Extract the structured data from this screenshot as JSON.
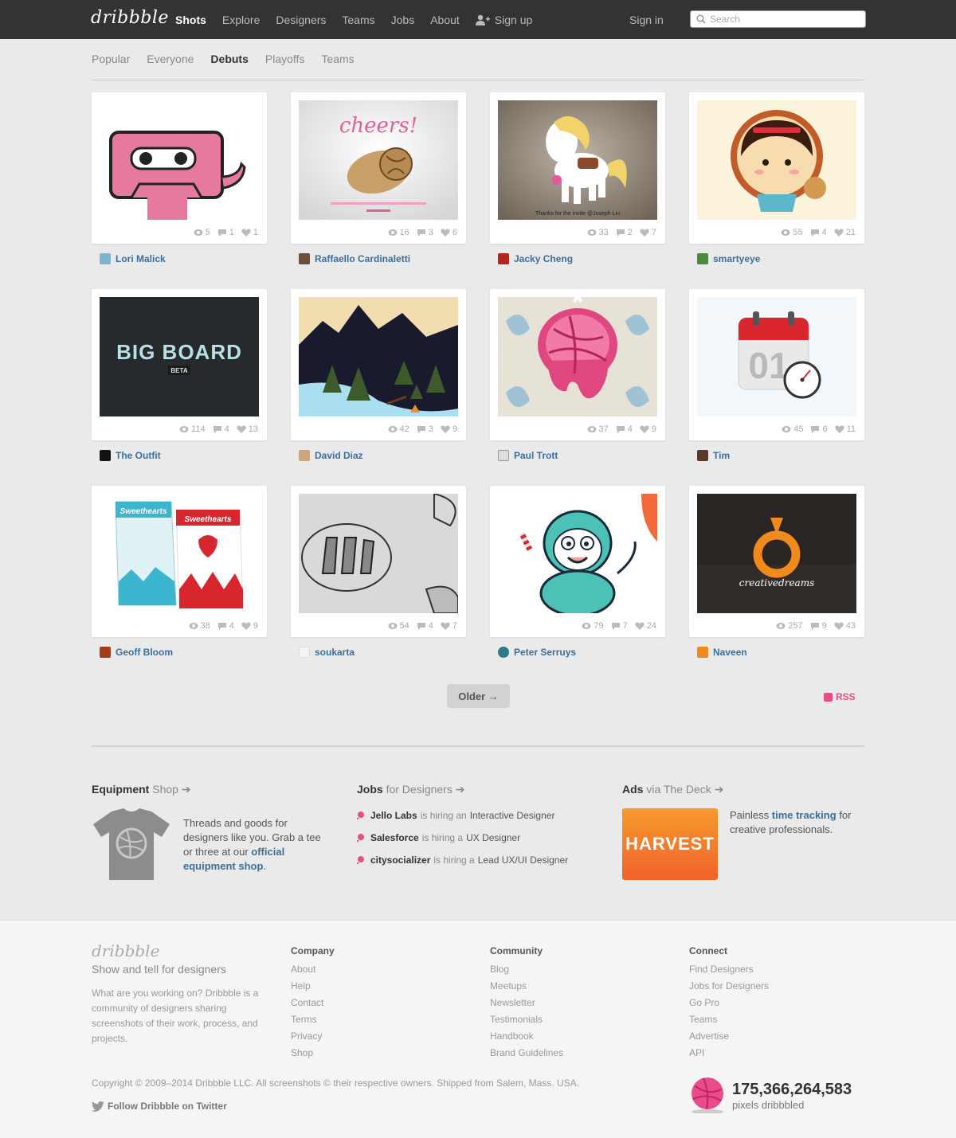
{
  "brand": "dribbble",
  "nav": {
    "items": [
      "Shots",
      "Explore",
      "Designers",
      "Teams",
      "Jobs",
      "About"
    ],
    "signup": "Sign up",
    "signin": "Sign in",
    "search_placeholder": "Search"
  },
  "subnav": [
    "Popular",
    "Everyone",
    "Debuts",
    "Playoffs",
    "Teams"
  ],
  "shots": [
    {
      "author": "Lori Malick",
      "views": "5",
      "comments": "1",
      "likes": "1"
    },
    {
      "author": "Raffaello Cardinaletti",
      "views": "16",
      "comments": "3",
      "likes": "6",
      "caption": "cheers!"
    },
    {
      "author": "Jacky Cheng",
      "views": "33",
      "comments": "2",
      "likes": "7",
      "caption": "Thanks for the invite @Joseph Liu"
    },
    {
      "author": "smartyeye",
      "views": "55",
      "comments": "4",
      "likes": "21"
    },
    {
      "author": "The Outfit",
      "views": "114",
      "comments": "4",
      "likes": "13",
      "caption": "BIG BOARD",
      "badge": "BETA"
    },
    {
      "author": "David Diaz",
      "views": "42",
      "comments": "3",
      "likes": "9"
    },
    {
      "author": "Paul Trott",
      "views": "37",
      "comments": "4",
      "likes": "9"
    },
    {
      "author": "Tim",
      "views": "45",
      "comments": "6",
      "likes": "11",
      "caption": "01"
    },
    {
      "author": "Geoff Bloom",
      "views": "38",
      "comments": "4",
      "likes": "9",
      "caption": "Sweethearts"
    },
    {
      "author": "soukarta",
      "views": "54",
      "comments": "4",
      "likes": "7"
    },
    {
      "author": "Peter Serruys",
      "views": "79",
      "comments": "7",
      "likes": "24"
    },
    {
      "author": "Naveen",
      "views": "257",
      "comments": "9",
      "likes": "43",
      "caption": "creativedreams"
    }
  ],
  "older_label": "Older →",
  "rss_label": "RSS",
  "promo": {
    "equipment": {
      "title": "Equipment",
      "sub": "Shop",
      "text1": "Threads and goods for designers like you. Grab a tee or three at our",
      "link": "official equipment shop",
      "text2": "."
    },
    "jobs": {
      "title": "Jobs",
      "sub": "for Designers",
      "hiring_word": "is hiring a",
      "hiring_word_an": "is hiring an",
      "items": [
        {
          "company": "Jello Labs",
          "role": "Interactive Designer"
        },
        {
          "company": "Salesforce",
          "role": "UX Designer"
        },
        {
          "company": "citysocializer",
          "role": "Lead UX/UI Designer"
        }
      ]
    },
    "ads": {
      "title": "Ads",
      "sub": "via The Deck",
      "badge": "HARVEST",
      "text1": "Painless",
      "link": "time tracking",
      "text2": "for creative professionals."
    }
  },
  "footer": {
    "logo": "dribbble",
    "tagline": "Show and tell for designers",
    "description": "What are you working on? Dribbble is a community of designers sharing screenshots of their work, process, and projects.",
    "company": {
      "title": "Company",
      "links": [
        "About",
        "Help",
        "Contact",
        "Terms",
        "Privacy",
        "Shop"
      ]
    },
    "community": {
      "title": "Community",
      "links": [
        "Blog",
        "Meetups",
        "Newsletter",
        "Testimonials",
        "Handbook",
        "Brand Guidelines"
      ]
    },
    "connect": {
      "title": "Connect",
      "links": [
        "Find Designers",
        "Jobs for Designers",
        "Go Pro",
        "Teams",
        "Advertise",
        "API"
      ]
    },
    "copyright": "Copyright © 2009–2014 Dribbble LLC. All screenshots © their respective owners. Shipped from Salem, Mass. USA.",
    "twitter": "Follow Dribbble on Twitter",
    "pixels_count": "175,366,264,583",
    "pixels_label": "pixels dribbbled"
  },
  "colors": {
    "accent": "#ea4c89",
    "link": "#3a6e9e",
    "nav_bg": "#333333",
    "page_bg": "#eaeaea"
  }
}
